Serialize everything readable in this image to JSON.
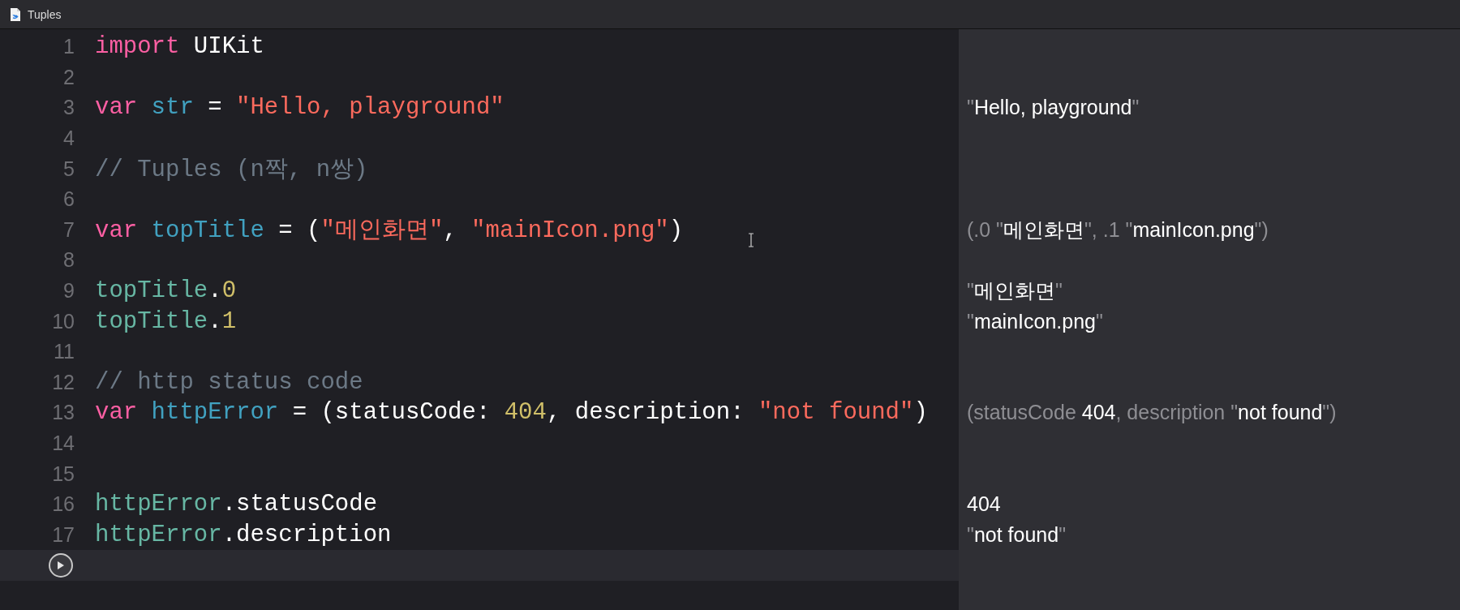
{
  "window": {
    "title": "Tuples"
  },
  "lines": [
    {
      "number": "1",
      "tokens": [
        {
          "kind": "keyword",
          "text": "import"
        },
        {
          "kind": "plain",
          "text": " UIKit"
        }
      ]
    },
    {
      "number": "2"
    },
    {
      "number": "3",
      "tokens": [
        {
          "kind": "keyword",
          "text": "var"
        },
        {
          "kind": "decl",
          "text": " str"
        },
        {
          "kind": "plain",
          "text": " = "
        },
        {
          "kind": "string",
          "text": "\"Hello, playground\""
        }
      ],
      "result": [
        {
          "kind": "muted",
          "text": "\""
        },
        {
          "kind": "value",
          "text": "Hello, playground"
        },
        {
          "kind": "muted",
          "text": "\""
        }
      ]
    },
    {
      "number": "4"
    },
    {
      "number": "5",
      "tokens": [
        {
          "kind": "comment",
          "text": "// Tuples (n짝, n쌍)"
        }
      ]
    },
    {
      "number": "6"
    },
    {
      "number": "7",
      "tokens": [
        {
          "kind": "keyword",
          "text": "var"
        },
        {
          "kind": "decl",
          "text": " topTitle"
        },
        {
          "kind": "plain",
          "text": " = ("
        },
        {
          "kind": "string",
          "text": "\"메인화면\""
        },
        {
          "kind": "plain",
          "text": ", "
        },
        {
          "kind": "string",
          "text": "\"mainIcon.png\""
        },
        {
          "kind": "plain",
          "text": ")"
        }
      ],
      "result": [
        {
          "kind": "muted",
          "text": "(.0 \""
        },
        {
          "kind": "value",
          "text": "메인화면"
        },
        {
          "kind": "muted",
          "text": "\", .1 \""
        },
        {
          "kind": "value",
          "text": "mainIcon.png"
        },
        {
          "kind": "muted",
          "text": "\")"
        }
      ]
    },
    {
      "number": "8"
    },
    {
      "number": "9",
      "tokens": [
        {
          "kind": "ref",
          "text": "topTitle"
        },
        {
          "kind": "plain",
          "text": "."
        },
        {
          "kind": "number",
          "text": "0"
        }
      ],
      "result": [
        {
          "kind": "muted",
          "text": "\""
        },
        {
          "kind": "value",
          "text": "메인화면"
        },
        {
          "kind": "muted",
          "text": "\""
        }
      ]
    },
    {
      "number": "10",
      "tokens": [
        {
          "kind": "ref",
          "text": "topTitle"
        },
        {
          "kind": "plain",
          "text": "."
        },
        {
          "kind": "number",
          "text": "1"
        }
      ],
      "result": [
        {
          "kind": "muted",
          "text": "\""
        },
        {
          "kind": "value",
          "text": "mainIcon.png"
        },
        {
          "kind": "muted",
          "text": "\""
        }
      ]
    },
    {
      "number": "11"
    },
    {
      "number": "12",
      "tokens": [
        {
          "kind": "comment",
          "text": "// http status code"
        }
      ]
    },
    {
      "number": "13",
      "tokens": [
        {
          "kind": "keyword",
          "text": "var"
        },
        {
          "kind": "decl",
          "text": " httpError"
        },
        {
          "kind": "plain",
          "text": " = (statusCode: "
        },
        {
          "kind": "number",
          "text": "404"
        },
        {
          "kind": "plain",
          "text": ", description: "
        },
        {
          "kind": "string",
          "text": "\"not found\""
        },
        {
          "kind": "plain",
          "text": ")"
        }
      ],
      "result": [
        {
          "kind": "muted",
          "text": "(statusCode "
        },
        {
          "kind": "value",
          "text": "404"
        },
        {
          "kind": "muted",
          "text": ", description \""
        },
        {
          "kind": "value",
          "text": "not found"
        },
        {
          "kind": "muted",
          "text": "\")"
        }
      ]
    },
    {
      "number": "14"
    },
    {
      "number": "15"
    },
    {
      "number": "16",
      "tokens": [
        {
          "kind": "ref",
          "text": "httpError"
        },
        {
          "kind": "plain",
          "text": ".statusCode"
        }
      ],
      "result": [
        {
          "kind": "value",
          "text": "404"
        }
      ]
    },
    {
      "number": "17",
      "tokens": [
        {
          "kind": "ref",
          "text": "httpError"
        },
        {
          "kind": "plain",
          "text": ".description"
        }
      ],
      "result": [
        {
          "kind": "muted",
          "text": "\""
        },
        {
          "kind": "value",
          "text": "not found"
        },
        {
          "kind": "muted",
          "text": "\""
        }
      ]
    }
  ]
}
